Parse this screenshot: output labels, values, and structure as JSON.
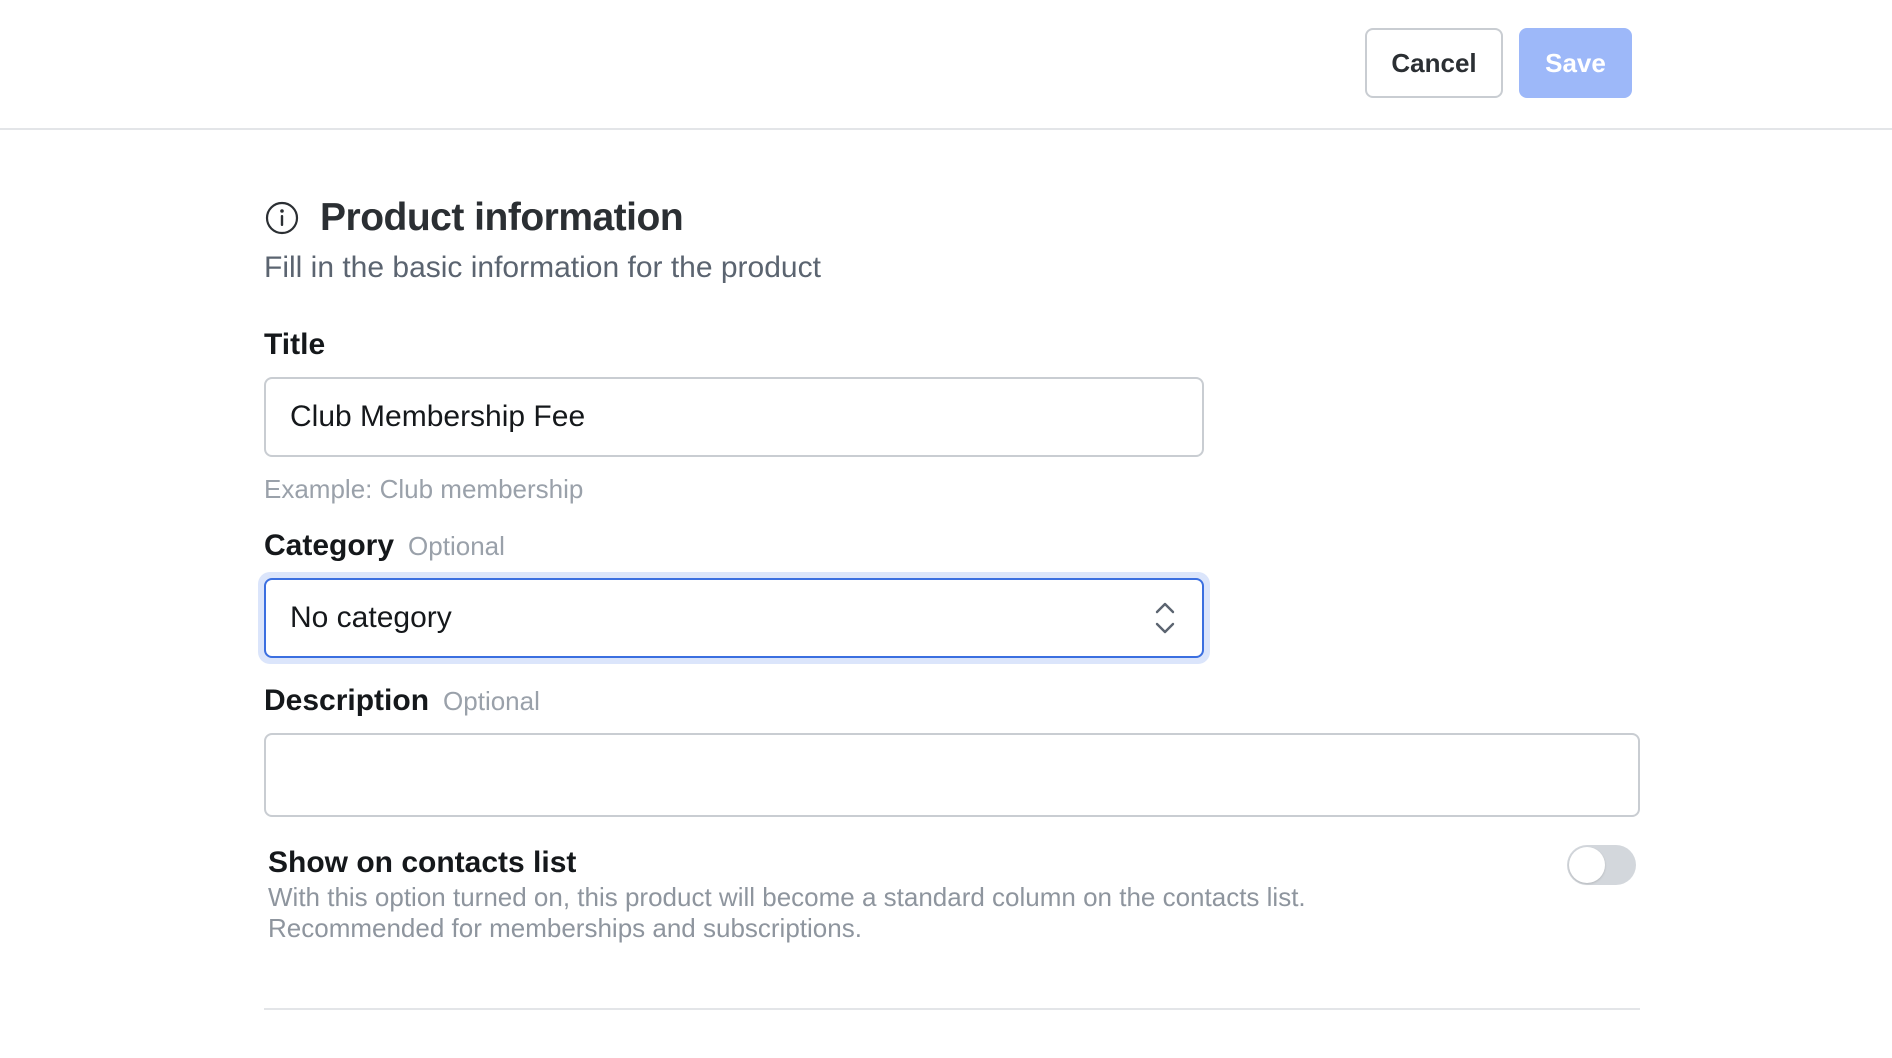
{
  "header": {
    "cancel_label": "Cancel",
    "save_label": "Save",
    "save_color": "#9db8f9"
  },
  "section": {
    "icon": "info-circle-icon",
    "title": "Product information",
    "subtitle": "Fill in the basic information for the product"
  },
  "form": {
    "title": {
      "label": "Title",
      "value": "Club Membership Fee",
      "helper": "Example: Club membership"
    },
    "category": {
      "label": "Category",
      "optional": "Optional",
      "selected": "No category",
      "focused": true,
      "focus_color": "#3b6fe0"
    },
    "description": {
      "label": "Description",
      "optional": "Optional",
      "value": ""
    },
    "show_on_contacts": {
      "label": "Show on contacts list",
      "description": "With this option turned on, this product will become a standard column on the contacts list. Recommended for memberships and subscriptions.",
      "enabled": false
    }
  }
}
